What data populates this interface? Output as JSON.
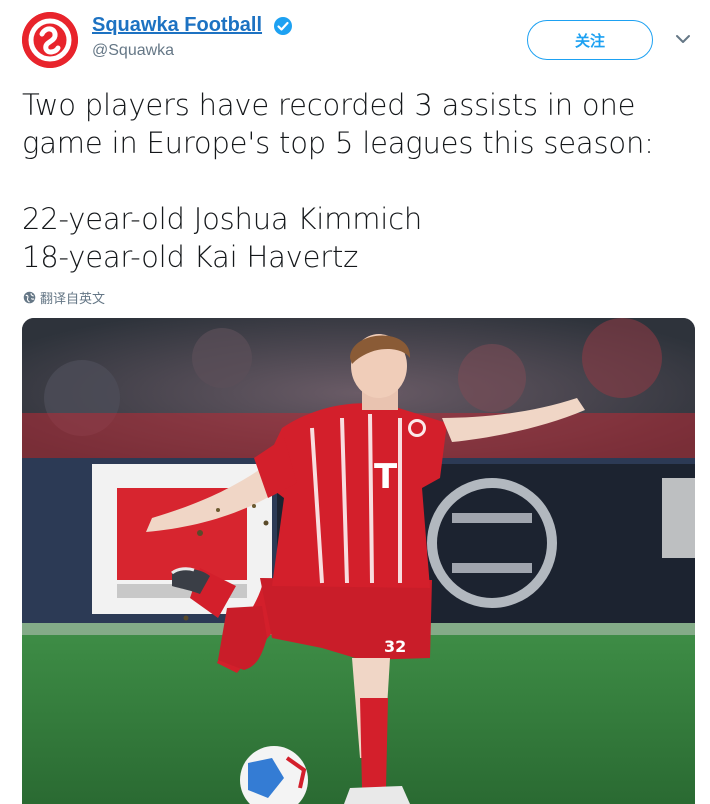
{
  "account": {
    "display_name": "Squawka Football",
    "handle": "@Squawka",
    "verified": true,
    "avatar_icon": "squawka-logo-icon"
  },
  "follow_button": {
    "label": "关注"
  },
  "menu": {
    "icon": "chevron-down-icon"
  },
  "tweet": {
    "lines": [
      "Two players have recorded 3 assists in one",
      "game in Europe's top 5 leagues this season:",
      "22-year-old Joshua Kimmich",
      "18-year-old Kai Havertz"
    ]
  },
  "translate": {
    "label": "翻译自英文",
    "icon": "globe-icon"
  },
  "media": {
    "kit_number": "32",
    "colors": {
      "kit_red": "#d31f2b",
      "pitch_green": "#2e7a3a",
      "accent": "#1da1f2"
    }
  }
}
